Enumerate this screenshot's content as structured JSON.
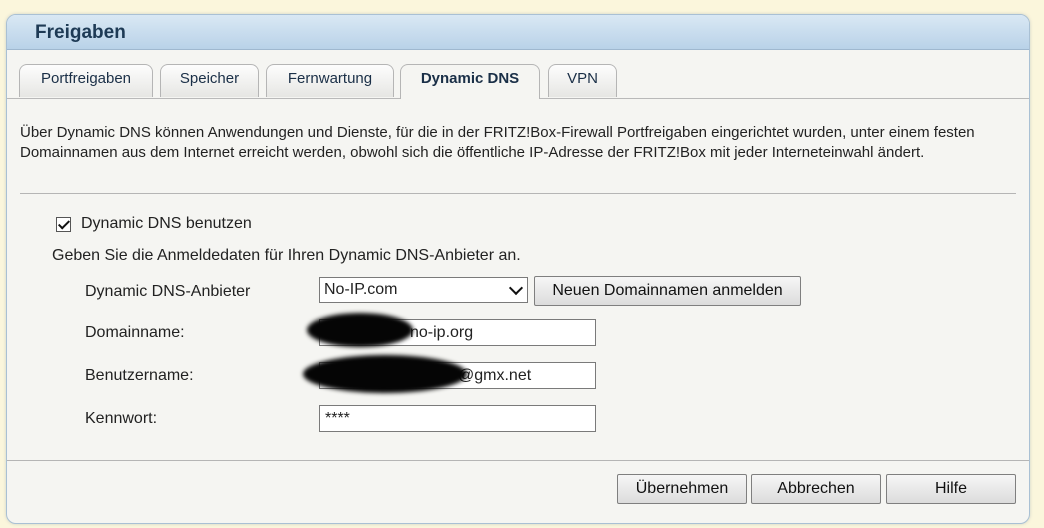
{
  "panel": {
    "title": "Freigaben"
  },
  "tabs": [
    {
      "label": "Portfreigaben"
    },
    {
      "label": "Speicher"
    },
    {
      "label": "Fernwartung"
    },
    {
      "label": "Dynamic DNS"
    },
    {
      "label": "VPN"
    }
  ],
  "active_tab": "Dynamic DNS",
  "description": "Über Dynamic DNS können Anwendungen und Dienste, für die in der FRITZ!Box-Firewall Portfreigaben eingerichtet wurden, unter einem festen Domainnamen aus dem Internet erreicht werden, obwohl sich die öffentliche IP-Adresse der FRITZ!Box mit jeder Interneteinwahl ändert.",
  "form": {
    "use_ddns": {
      "label": "Dynamic DNS benutzen",
      "checked": true
    },
    "instruction": "Geben Sie die Anmeldedaten für Ihren Dynamic DNS-Anbieter an.",
    "provider": {
      "label": "Dynamic DNS-Anbieter",
      "value": "No-IP.com",
      "register_button": "Neuen Domainnamen anmelden"
    },
    "domain": {
      "label": "Domainname:",
      "value": "no-ip.org"
    },
    "username": {
      "label": "Benutzername:",
      "value": "@gmx.net"
    },
    "password": {
      "label": "Kennwort:",
      "value": "****"
    }
  },
  "buttons": {
    "apply": "Übernehmen",
    "cancel": "Abbrechen",
    "help": "Hilfe"
  }
}
